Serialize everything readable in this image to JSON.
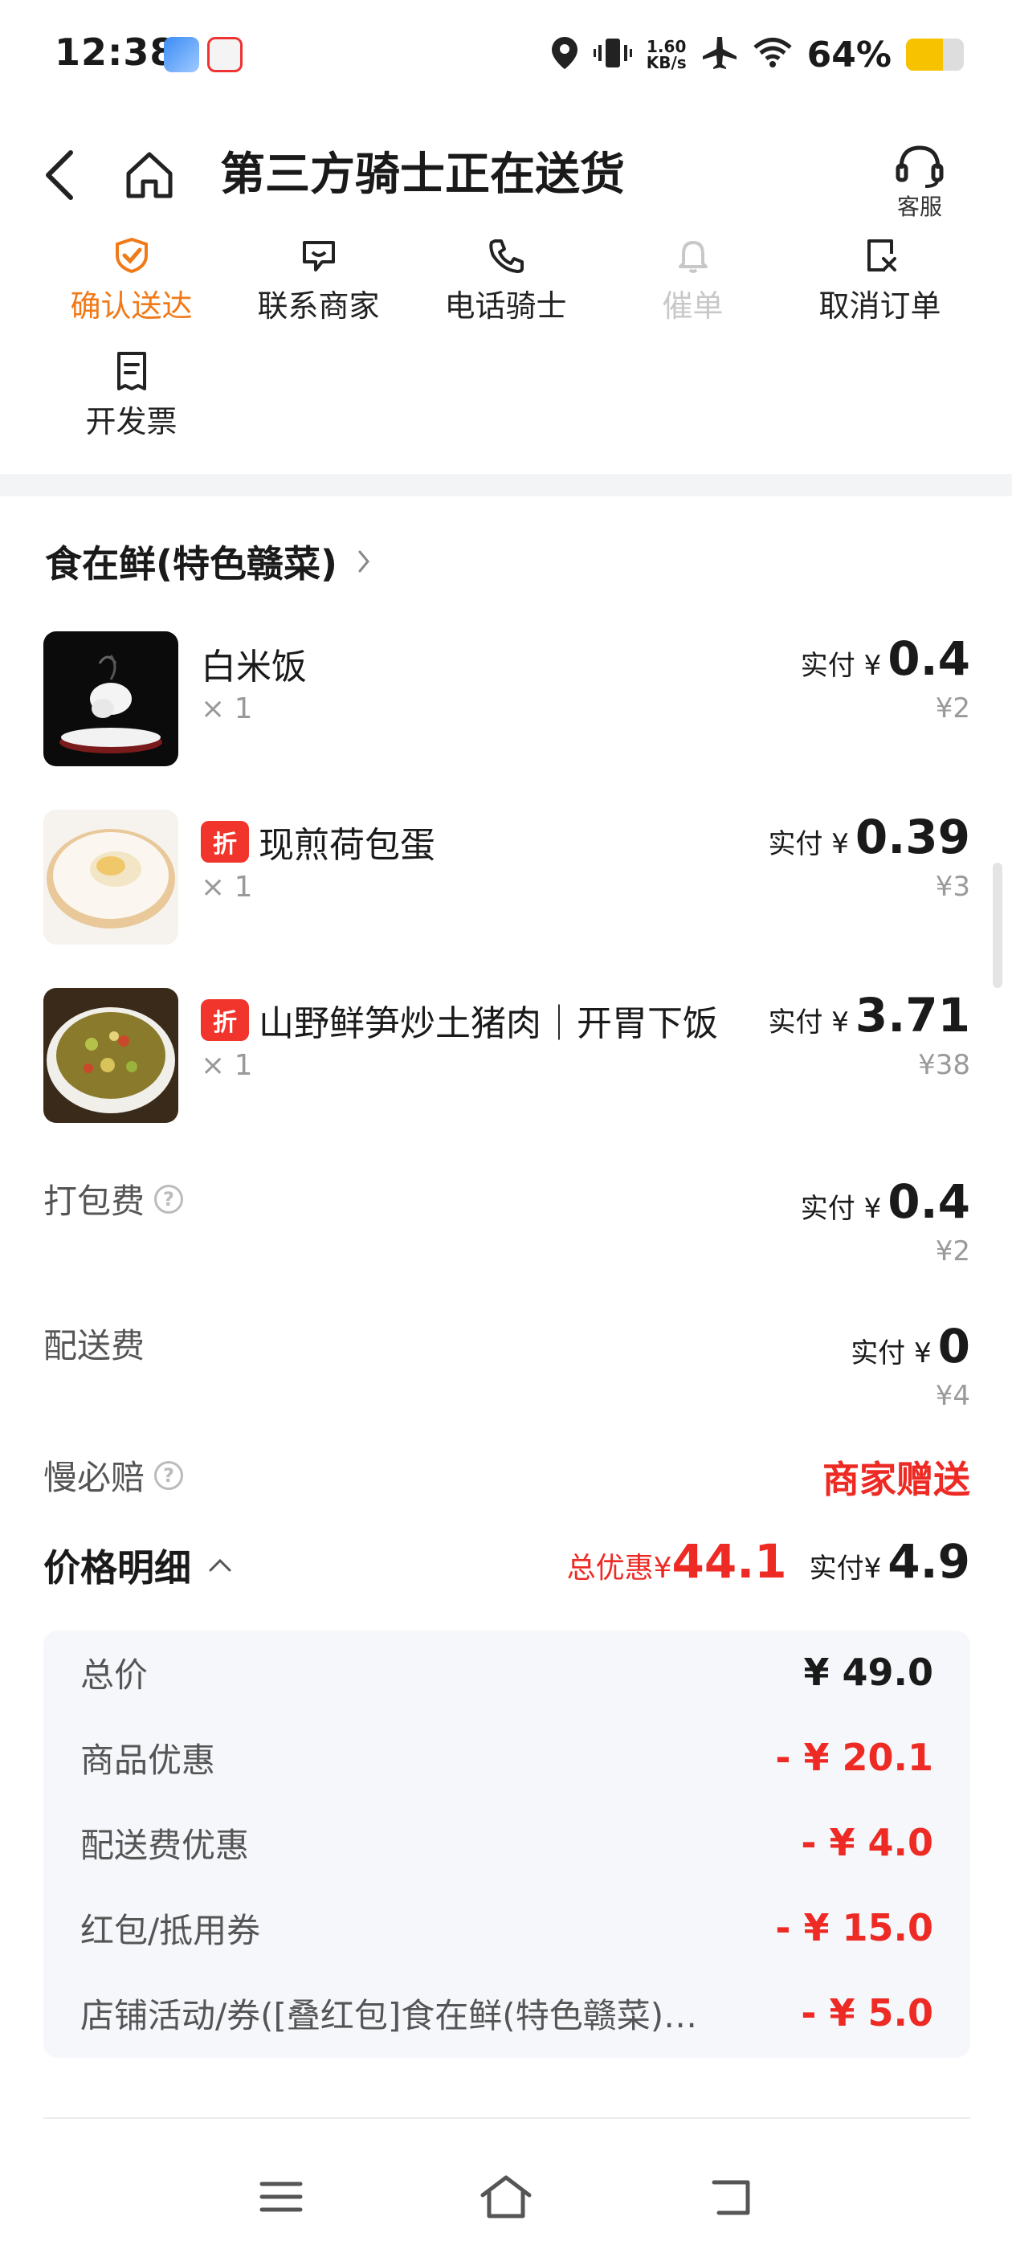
{
  "status_bar": {
    "time": "12:38",
    "net_speed_top": "1.60",
    "net_speed_bottom": "KB/s",
    "battery_percent": "64%",
    "battery_level": 0.64,
    "icons": [
      "location-icon",
      "vibrate-icon",
      "airplane-icon",
      "wifi-icon",
      "battery-icon"
    ]
  },
  "header": {
    "title": "第三方骑士正在送货",
    "service_label": "客服"
  },
  "actions": [
    {
      "label": "确认送达",
      "icon": "check-shield-icon",
      "state": "active"
    },
    {
      "label": "联系商家",
      "icon": "chat-icon",
      "state": "normal"
    },
    {
      "label": "电话骑士",
      "icon": "phone-icon",
      "state": "normal"
    },
    {
      "label": "催单",
      "icon": "bell-icon",
      "state": "disabled"
    },
    {
      "label": "取消订单",
      "icon": "cancel-doc-icon",
      "state": "normal"
    },
    {
      "label": "开发票",
      "icon": "invoice-icon",
      "state": "normal"
    }
  ],
  "shop": {
    "name": "食在鲜(特色赣菜)"
  },
  "items": [
    {
      "name": "白米饭",
      "qty": "× 1",
      "paid_label": "实付",
      "currency": "¥",
      "paid": "0.4",
      "original": "¥2",
      "discount_tag": ""
    },
    {
      "name": "现煎荷包蛋",
      "qty": "× 1",
      "paid_label": "实付",
      "currency": "¥",
      "paid": "0.39",
      "original": "¥3",
      "discount_tag": "折"
    },
    {
      "name": "山野鲜笋炒土猪肉｜开胃下饭",
      "qty": "× 1",
      "paid_label": "实付",
      "currency": "¥",
      "paid": "3.71",
      "original": "¥38",
      "discount_tag": "折"
    }
  ],
  "fees": {
    "packing": {
      "label": "打包费",
      "paid_label": "实付",
      "currency": "¥",
      "paid": "0.4",
      "original": "¥2"
    },
    "delivery": {
      "label": "配送费",
      "paid_label": "实付",
      "currency": "¥",
      "paid": "0",
      "original": "¥4"
    },
    "late_comp": {
      "label": "慢必赔",
      "value": "商家赠送"
    }
  },
  "price_detail": {
    "title": "价格明细",
    "total_discount_label": "总优惠",
    "currency": "¥",
    "total_discount": "44.1",
    "paid_label": "实付",
    "paid": "4.9",
    "rows": [
      {
        "label": "总价",
        "value": "¥ 49.0",
        "red": false
      },
      {
        "label": "商品优惠",
        "value": "- ¥ 20.1",
        "red": true
      },
      {
        "label": "配送费优惠",
        "value": "- ¥ 4.0",
        "red": true
      },
      {
        "label": "红包/抵用券",
        "value": "- ¥ 15.0",
        "red": true
      },
      {
        "label": "店铺活动/券([叠红包]食在鲜(特色赣菜)…",
        "value": "- ¥ 5.0",
        "red": true
      }
    ]
  },
  "colors": {
    "accent_orange": "#f07a18",
    "red": "#ee2a24",
    "muted": "#9a9a9a"
  }
}
